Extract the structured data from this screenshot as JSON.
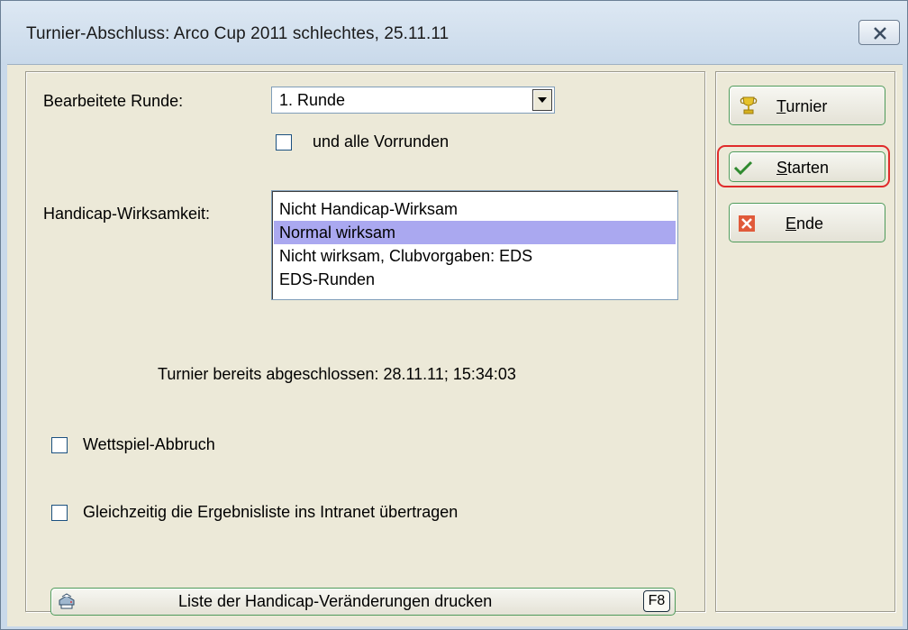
{
  "window": {
    "title": "Turnier-Abschluss: Arco Cup 2011 schlechtes, 25.11.11"
  },
  "round": {
    "label": "Bearbeitete Runde:",
    "selected": "1. Runde",
    "all_prior_label": "und alle Vorrunden",
    "all_prior_checked": false
  },
  "handicap": {
    "label": "Handicap-Wirksamkeit:",
    "options": [
      "Nicht Handicap-Wirksam",
      "Normal wirksam",
      "Nicht wirksam, Clubvorgaben: EDS",
      "EDS-Runden"
    ],
    "selected_index": 1
  },
  "status": {
    "text": "Turnier bereits abgeschlossen: 28.11.11; 15:34:03"
  },
  "options": {
    "abort_label": "Wettspiel-Abbruch",
    "abort_checked": false,
    "intranet_label": "Gleichzeitig die Ergebnisliste ins Intranet übertragen",
    "intranet_checked": false
  },
  "print_button": {
    "label": "Liste der Handicap-Veränderungen drucken",
    "shortcut": "F8",
    "icon": "printer-icon"
  },
  "side_buttons": {
    "turnier_first": "T",
    "turnier_rest": "urnier",
    "starten_first": "S",
    "starten_rest": "tarten",
    "ende_first": "E",
    "ende_rest": "nde",
    "icons": [
      "trophy-icon",
      "checkmark-icon",
      "red-x-icon"
    ]
  },
  "colors": {
    "selection": "#aaa8f0",
    "highlight": "#e02b2b",
    "button_border": "#4e9a5a",
    "dialog_bg": "#ece9d8"
  }
}
